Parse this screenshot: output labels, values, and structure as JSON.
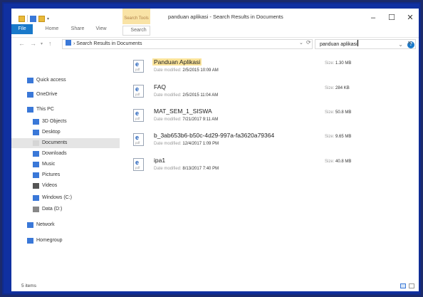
{
  "window": {
    "title": "panduan aplikasi - Search Results in Documents",
    "context_tab": "Search Tools"
  },
  "ribbon": {
    "tabs": [
      "File",
      "Home",
      "Share",
      "View",
      "Search"
    ]
  },
  "address": {
    "path": "Search Results in Documents",
    "search_value": "panduan aplikasi"
  },
  "nav": {
    "items": [
      {
        "label": "Quick access",
        "icon": "star-icon"
      },
      {
        "label": "OneDrive",
        "icon": "cloud-icon"
      },
      {
        "label": "This PC",
        "icon": "computer-icon"
      },
      {
        "label": "3D Objects",
        "icon": "cube-icon"
      },
      {
        "label": "Desktop",
        "icon": "desktop-icon"
      },
      {
        "label": "Documents",
        "icon": "document-icon"
      },
      {
        "label": "Downloads",
        "icon": "download-icon"
      },
      {
        "label": "Music",
        "icon": "music-icon"
      },
      {
        "label": "Pictures",
        "icon": "pictures-icon"
      },
      {
        "label": "Videos",
        "icon": "video-icon"
      },
      {
        "label": "Windows (C:)",
        "icon": "drive-icon"
      },
      {
        "label": "Data (D:)",
        "icon": "drive-icon"
      },
      {
        "label": "Network",
        "icon": "network-icon"
      },
      {
        "label": "Homegroup",
        "icon": "homegroup-icon"
      }
    ]
  },
  "files": [
    {
      "name": "Panduan Aplikasi",
      "date_label": "Date modified:",
      "date": "2/5/2015 10:09 AM",
      "size_label": "Size:",
      "size": "1.30 MB"
    },
    {
      "name": "FAQ",
      "date_label": "Date modified:",
      "date": "2/5/2015 11:04 AM",
      "size_label": "Size:",
      "size": "284 KB"
    },
    {
      "name": "MAT_SEM_1_SISWA",
      "date_label": "Date modified:",
      "date": "7/21/2017 9:11 AM",
      "size_label": "Size:",
      "size": "50.8 MB"
    },
    {
      "name": "b_3ab653b6-b50c-4d29-997a-fa3620a79364",
      "date_label": "Date modified:",
      "date": "12/4/2017 1:09 PM",
      "size_label": "Size:",
      "size": "9.65 MB"
    },
    {
      "name": "ipa1",
      "date_label": "Date modified:",
      "date": "8/13/2017 7:40 PM",
      "size_label": "Size:",
      "size": "40.8 MB"
    }
  ],
  "file_icon_caption": "pdf",
  "status": {
    "item_count": "5 items"
  },
  "colors": {
    "accent": "#1979ca",
    "highlight": "#fbe49a",
    "context_tab": "#f9e3a6"
  }
}
